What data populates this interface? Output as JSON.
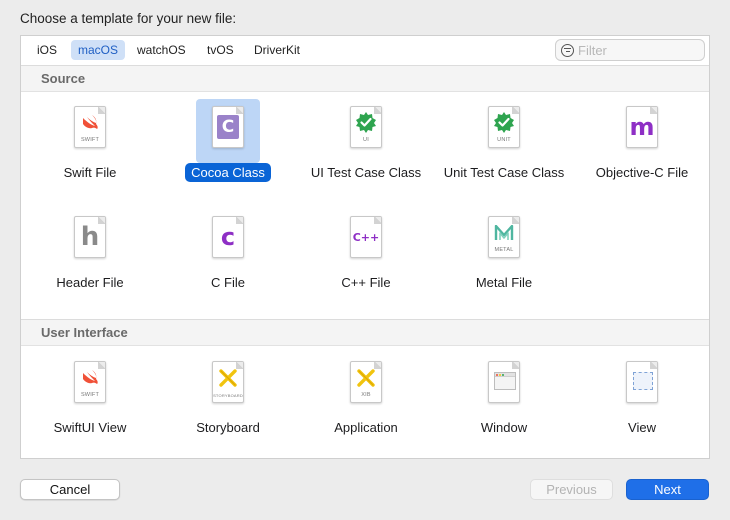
{
  "prompt": "Choose a template for your new file:",
  "tabs": [
    "iOS",
    "macOS",
    "watchOS",
    "tvOS",
    "DriverKit"
  ],
  "selected_tab": "macOS",
  "filter": {
    "placeholder": "Filter",
    "value": ""
  },
  "sections": [
    {
      "title": "Source",
      "items": [
        {
          "label": "Swift File",
          "icon": "swift-icon",
          "glyph": "",
          "sub": "SWIFT"
        },
        {
          "label": "Cocoa Class",
          "icon": "cocoa-class-icon",
          "glyph": "C",
          "sub": "",
          "selected": true
        },
        {
          "label": "UI Test Case Class",
          "icon": "checkmark-icon",
          "glyph": "",
          "sub": "UI"
        },
        {
          "label": "Unit Test Case Class",
          "icon": "checkmark-icon",
          "glyph": "",
          "sub": "UNIT"
        },
        {
          "label": "Objective-C File",
          "icon": "objc-m-icon",
          "glyph": "m",
          "sub": ""
        },
        {
          "label": "Header File",
          "icon": "header-h-icon",
          "glyph": "h",
          "sub": ""
        },
        {
          "label": "C File",
          "icon": "c-letter-icon",
          "glyph": "c",
          "sub": ""
        },
        {
          "label": "C++ File",
          "icon": "cpp-icon",
          "glyph": "C++",
          "sub": ""
        },
        {
          "label": "Metal File",
          "icon": "metal-icon",
          "glyph": "",
          "sub": "METAL"
        }
      ]
    },
    {
      "title": "User Interface",
      "items": [
        {
          "label": "SwiftUI View",
          "icon": "swift-icon",
          "glyph": "",
          "sub": "SWIFT"
        },
        {
          "label": "Storyboard",
          "icon": "storyboard-icon",
          "glyph": "",
          "sub": "STORYBOARD"
        },
        {
          "label": "Application",
          "icon": "xib-icon",
          "glyph": "",
          "sub": "XIB"
        },
        {
          "label": "Window",
          "icon": "window-icon",
          "glyph": "",
          "sub": ""
        },
        {
          "label": "View",
          "icon": "view-icon",
          "glyph": "",
          "sub": ""
        }
      ]
    }
  ],
  "buttons": {
    "cancel": "Cancel",
    "previous": "Previous",
    "next": "Next"
  },
  "colors": {
    "accent": "#1f6fe8",
    "selection": "#0a64d6",
    "swift": "#f05138",
    "check": "#2ea44f",
    "objc": "#8e2fc5",
    "metal": "#4fb6a0",
    "xib": "#f1c40f"
  }
}
